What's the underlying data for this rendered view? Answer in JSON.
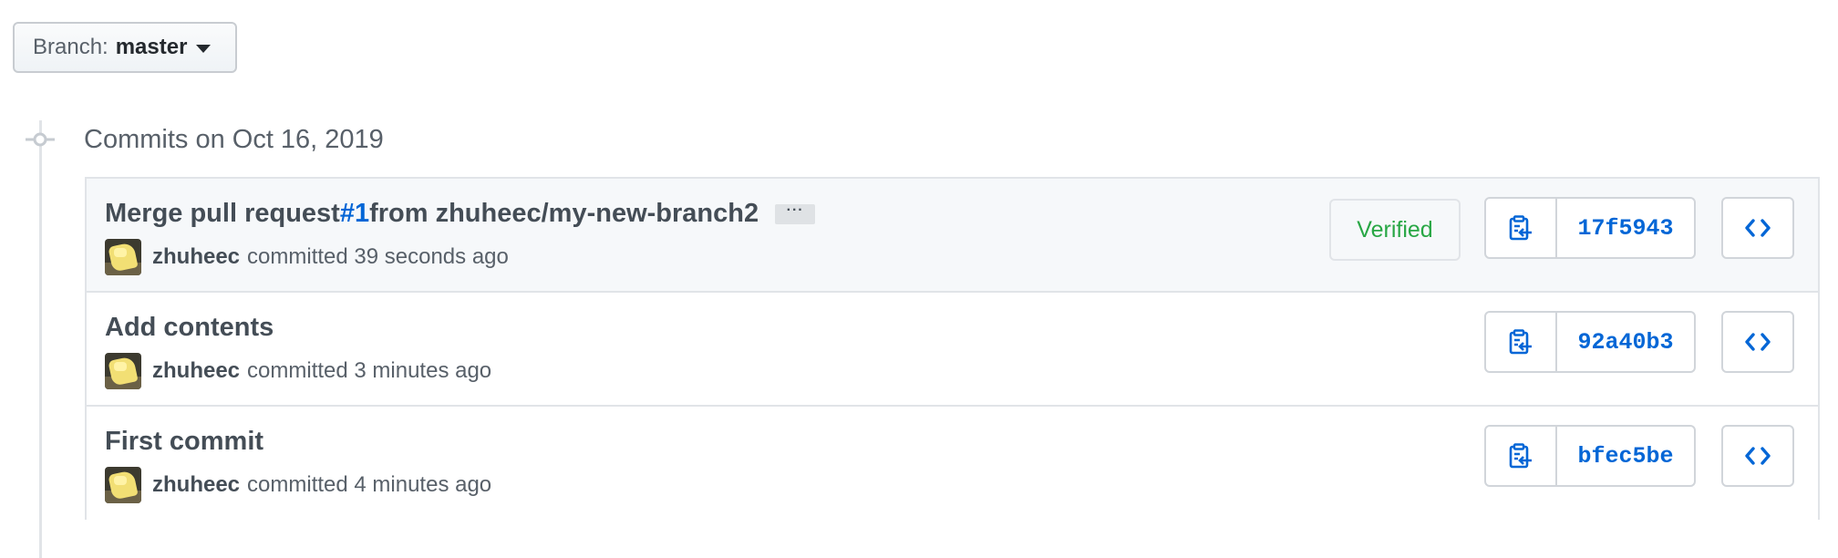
{
  "branch": {
    "label": "Branch:",
    "value": "master"
  },
  "group": {
    "title": "Commits on Oct 16, 2019"
  },
  "commits": [
    {
      "message_prefix": "Merge pull request ",
      "issue": "#1",
      "message_suffix": " from zhuheec/my-new-branch2",
      "has_more": true,
      "more_label": "···",
      "author": "zhuheec",
      "committed_text": "committed 39 seconds ago",
      "verified": "Verified",
      "sha": "17f5943"
    },
    {
      "message_prefix": "Add contents",
      "author": "zhuheec",
      "committed_text": "committed 3 minutes ago",
      "sha": "92a40b3"
    },
    {
      "message_prefix": "First commit",
      "author": "zhuheec",
      "committed_text": "committed 4 minutes ago",
      "sha": "bfec5be"
    }
  ],
  "icons": {
    "timeline": "git-commit-icon",
    "copy": "clippy-icon",
    "browse": "code-icon"
  },
  "colors": {
    "link": "#0366d6",
    "verified": "#28a745",
    "highlight_row": "#f6f8fa"
  }
}
